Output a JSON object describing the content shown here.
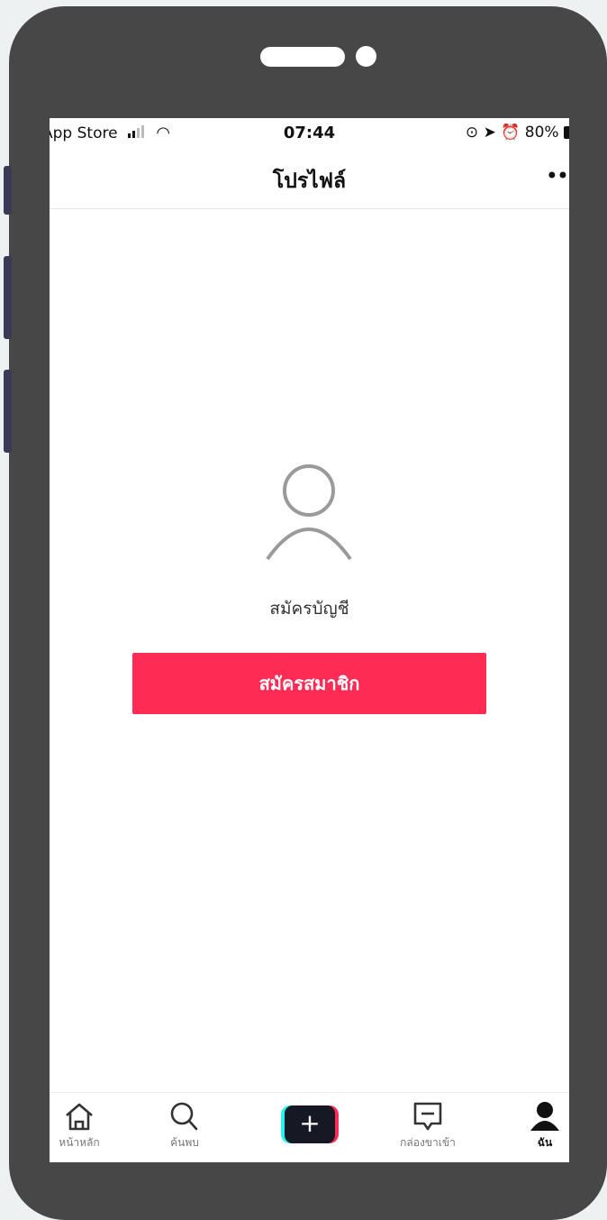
{
  "status_bar": {
    "carrier": "App Store",
    "time": "07:44",
    "battery": "80%"
  },
  "header": {
    "title": "โปรไฟล์",
    "more": "••"
  },
  "main": {
    "prompt": "สมัครบัญชี",
    "signup_label": "สมัครสมาชิก",
    "signup_color": "#fe2c55"
  },
  "tabbar": {
    "home": "หน้าหลัก",
    "discover": "ค้นพบ",
    "create": "+",
    "inbox": "กล่องขาเข้า",
    "me": "ฉัน"
  }
}
